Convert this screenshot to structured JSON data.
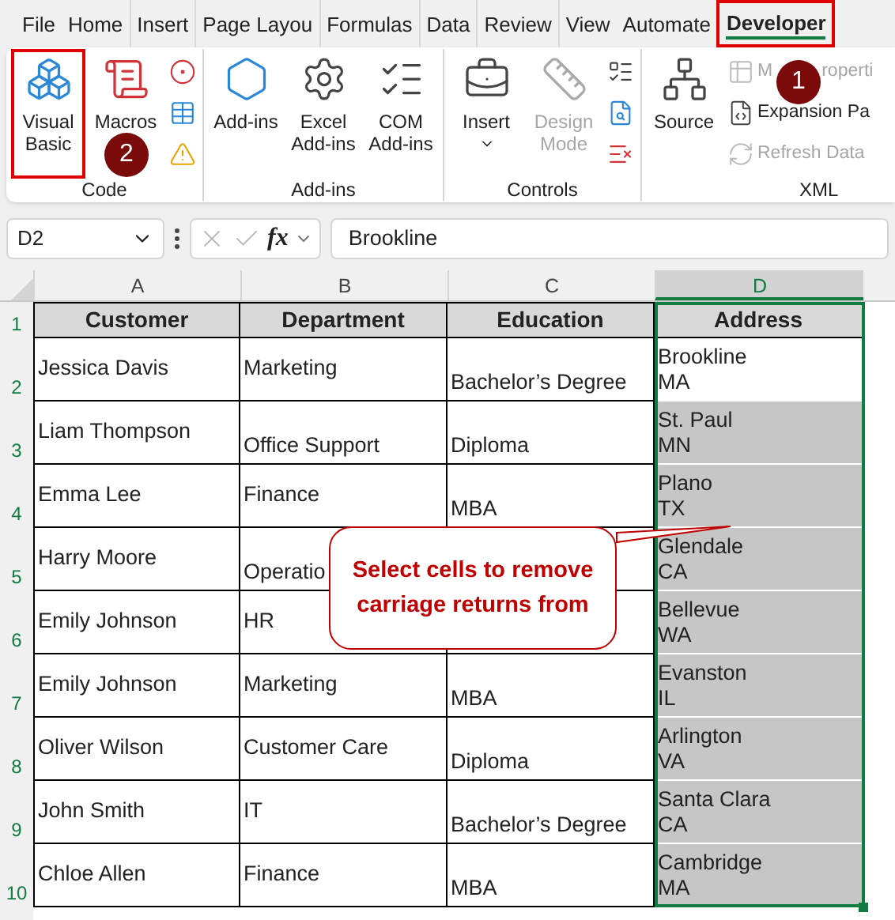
{
  "tabs": [
    {
      "label": "File",
      "selected": false,
      "highlighted": false
    },
    {
      "label": "Home",
      "selected": false,
      "highlighted": false
    },
    {
      "label": "Insert",
      "selected": false,
      "highlighted": false
    },
    {
      "label": "Page Layou",
      "selected": false,
      "highlighted": false
    },
    {
      "label": "Formulas",
      "selected": false,
      "highlighted": false
    },
    {
      "label": "Data",
      "selected": false,
      "highlighted": false
    },
    {
      "label": "Review",
      "selected": false,
      "highlighted": false
    },
    {
      "label": "View",
      "selected": false,
      "highlighted": false
    },
    {
      "label": "Automate",
      "selected": false,
      "highlighted": false
    },
    {
      "label": "Developer",
      "selected": true,
      "highlighted": true
    }
  ],
  "ribbon": {
    "groups": [
      {
        "label": "Code",
        "items": [
          {
            "kind": "large",
            "label": "Visual Basic",
            "disabled": false,
            "highlighted": true
          },
          {
            "kind": "large",
            "label": "Macros",
            "disabled": false,
            "highlighted": false
          }
        ]
      },
      {
        "label": "Add-ins",
        "items": [
          {
            "kind": "large",
            "label": "Add-ins",
            "disabled": false,
            "highlighted": false
          },
          {
            "kind": "large",
            "label": "Excel Add-ins",
            "disabled": false,
            "highlighted": false
          },
          {
            "kind": "large",
            "label": "COM Add-ins",
            "disabled": false,
            "highlighted": false
          }
        ]
      },
      {
        "label": "Controls",
        "items": [
          {
            "kind": "dropdown",
            "label": "Insert",
            "disabled": false,
            "highlighted": false
          },
          {
            "kind": "large",
            "label": "Design Mode",
            "disabled": true,
            "highlighted": false
          }
        ]
      },
      {
        "label": "XML",
        "items": [
          {
            "kind": "large",
            "label": "Source",
            "disabled": false,
            "highlighted": false
          },
          {
            "kind": "small",
            "label_parts": [
              "M",
              "roperti"
            ],
            "disabled": true,
            "highlighted": false
          },
          {
            "kind": "small",
            "label": "Expansion Pa",
            "disabled": false,
            "highlighted": false
          },
          {
            "kind": "small",
            "label": "Refresh Data",
            "disabled": true,
            "highlighted": false
          }
        ]
      }
    ]
  },
  "step_badges": [
    {
      "label": "1"
    },
    {
      "label": "2"
    }
  ],
  "formula_bar": {
    "name_box": "D2",
    "function_label": "fx",
    "value": "Brookline"
  },
  "sheet": {
    "columns": [
      {
        "label": "A",
        "selected": false
      },
      {
        "label": "B",
        "selected": false
      },
      {
        "label": "C",
        "selected": false
      },
      {
        "label": "D",
        "selected": true
      }
    ],
    "header_row": {
      "number": "1",
      "cells": [
        "Customer",
        "Department",
        "Education",
        "Address"
      ]
    },
    "rows": [
      {
        "number": "2",
        "cells": [
          {
            "text": "Jessica Davis",
            "bottom_aligned": false
          },
          {
            "text": "Marketing",
            "bottom_aligned": false
          },
          {
            "text": "Bachelor’s Degree",
            "bottom_aligned": true
          }
        ],
        "address": {
          "lines": [
            "Brookline",
            "MA"
          ],
          "active": true
        }
      },
      {
        "number": "3",
        "cells": [
          {
            "text": "Liam Thompson",
            "bottom_aligned": false
          },
          {
            "text": "Office Support",
            "bottom_aligned": true
          },
          {
            "text": "Diploma",
            "bottom_aligned": true
          }
        ],
        "address": {
          "lines": [
            "St. Paul",
            "MN"
          ],
          "active": false
        }
      },
      {
        "number": "4",
        "cells": [
          {
            "text": "Emma Lee",
            "bottom_aligned": false
          },
          {
            "text": "Finance",
            "bottom_aligned": false
          },
          {
            "text": "MBA",
            "bottom_aligned": true
          }
        ],
        "address": {
          "lines": [
            "Plano",
            "TX"
          ],
          "active": false
        }
      },
      {
        "number": "5",
        "cells": [
          {
            "text": "Harry Moore",
            "bottom_aligned": false
          },
          {
            "text": "Operatio",
            "bottom_aligned": true
          },
          {}
        ],
        "address": {
          "lines": [
            "Glendale",
            "CA"
          ],
          "active": false
        }
      },
      {
        "number": "6",
        "cells": [
          {
            "text": "Emily Johnson",
            "bottom_aligned": false
          },
          {
            "text": "HR",
            "bottom_aligned": false
          },
          {}
        ],
        "address": {
          "lines": [
            "Bellevue",
            "WA"
          ],
          "active": false
        }
      },
      {
        "number": "7",
        "cells": [
          {
            "text": "Emily Johnson",
            "bottom_aligned": false
          },
          {
            "text": "Marketing",
            "bottom_aligned": false
          },
          {
            "text": "MBA",
            "bottom_aligned": true
          }
        ],
        "address": {
          "lines": [
            "Evanston",
            "IL"
          ],
          "active": false
        }
      },
      {
        "number": "8",
        "cells": [
          {
            "text": "Oliver Wilson",
            "bottom_aligned": false
          },
          {
            "text": "Customer Care",
            "bottom_aligned": false
          },
          {
            "text": "Diploma",
            "bottom_aligned": true
          }
        ],
        "address": {
          "lines": [
            "Arlington",
            "VA"
          ],
          "active": false
        }
      },
      {
        "number": "9",
        "cells": [
          {
            "text": "John Smith",
            "bottom_aligned": false
          },
          {
            "text": "IT",
            "bottom_aligned": false
          },
          {
            "text": "Bachelor’s Degree",
            "bottom_aligned": true
          }
        ],
        "address": {
          "lines": [
            "Santa Clara",
            "CA"
          ],
          "active": false
        }
      },
      {
        "number": "10",
        "cells": [
          {
            "text": "Chloe Allen",
            "bottom_aligned": false
          },
          {
            "text": "Finance",
            "bottom_aligned": false
          },
          {
            "text": "MBA",
            "bottom_aligned": true
          }
        ],
        "address": {
          "lines": [
            "Cambridge",
            "MA"
          ],
          "active": false
        }
      }
    ]
  },
  "callout": {
    "text": "Select cells to remove carriage returns from"
  }
}
